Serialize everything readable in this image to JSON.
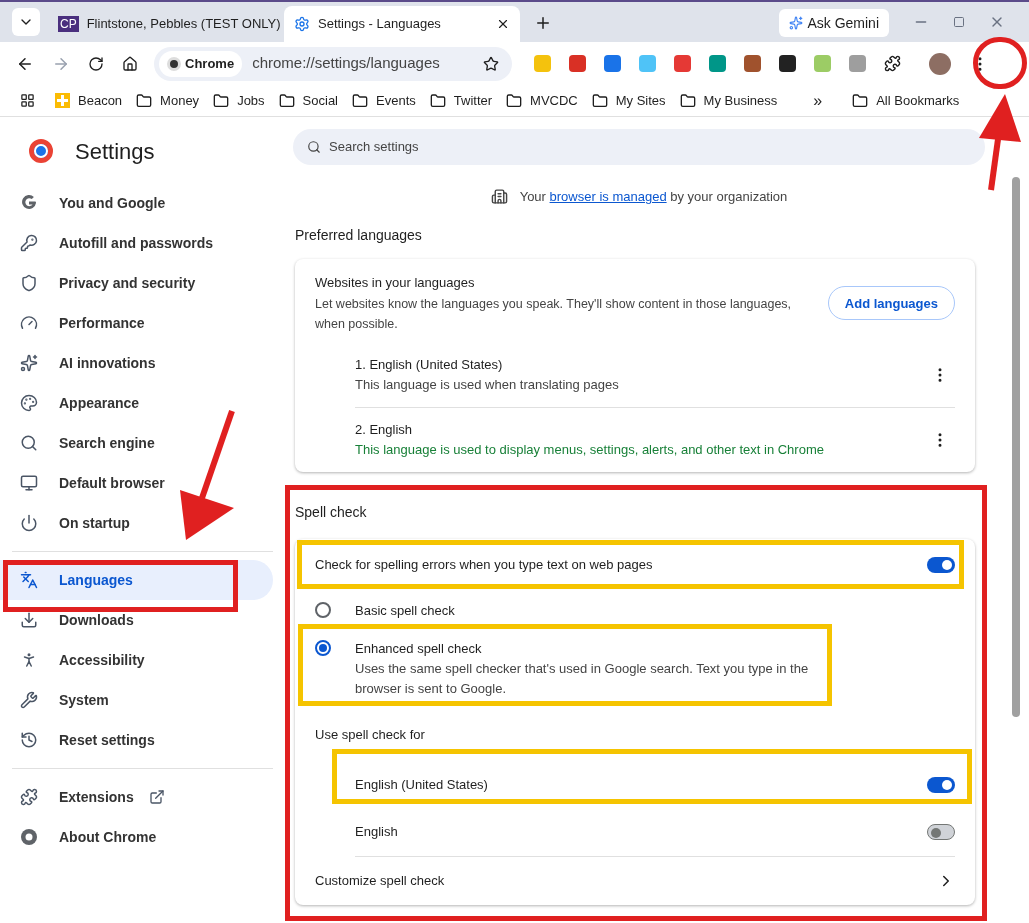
{
  "tabs": [
    {
      "badge": "CP",
      "label": "Flintstone, Pebbles (TEST ONLY)",
      "selected": false,
      "kind": "badge"
    },
    {
      "label": "Settings - Languages",
      "selected": true,
      "kind": "gear"
    }
  ],
  "gemini": "Ask Gemini",
  "address": {
    "chip": "Chrome",
    "url": "chrome://settings/languages"
  },
  "bookmarks": [
    {
      "label": "Beacon",
      "kind": "plus"
    },
    {
      "label": "Money",
      "kind": "folder"
    },
    {
      "label": "Jobs",
      "kind": "folder"
    },
    {
      "label": "Social",
      "kind": "folder"
    },
    {
      "label": "Events",
      "kind": "folder"
    },
    {
      "label": "Twitter",
      "kind": "folder"
    },
    {
      "label": "MVCDC",
      "kind": "folder"
    },
    {
      "label": "My Sites",
      "kind": "folder"
    },
    {
      "label": "My Business",
      "kind": "folder"
    }
  ],
  "overflow": "»",
  "all_bookmarks": "All Bookmarks",
  "sidebar": {
    "title": "Settings",
    "groups": [
      [
        {
          "label": "You and Google",
          "selected": false
        },
        {
          "label": "Autofill and passwords",
          "selected": false
        },
        {
          "label": "Privacy and security",
          "selected": false
        },
        {
          "label": "Performance",
          "selected": false
        },
        {
          "label": "AI innovations",
          "selected": false
        },
        {
          "label": "Appearance",
          "selected": false
        },
        {
          "label": "Search engine",
          "selected": false
        },
        {
          "label": "Default browser",
          "selected": false
        },
        {
          "label": "On startup",
          "selected": false
        }
      ],
      [
        {
          "label": "Languages",
          "selected": true
        },
        {
          "label": "Downloads",
          "selected": false
        },
        {
          "label": "Accessibility",
          "selected": false
        },
        {
          "label": "System",
          "selected": false
        },
        {
          "label": "Reset settings",
          "selected": false
        }
      ],
      [
        {
          "label": "Extensions",
          "selected": false
        },
        {
          "label": "About Chrome",
          "selected": false
        }
      ]
    ]
  },
  "search": {
    "placeholder": "Search settings"
  },
  "managed": {
    "before": "Your",
    "link": "browser is managed",
    "after": "by your organization"
  },
  "preferred": {
    "heading": "Preferred languages",
    "title": "Websites in your languages",
    "description": "Let websites know the languages you speak. They'll show content in those languages, when possible.",
    "button": "Add languages",
    "languages": [
      {
        "name": "1. English (United States)",
        "note": "This language is used when translating pages",
        "highlight": false
      },
      {
        "name": "2. English",
        "note": "This language is used to display menus, settings, alerts, and other text in Chrome",
        "highlight": true
      }
    ]
  },
  "spell": {
    "heading": "Spell check",
    "toggle": {
      "label": "Check for spelling errors when you type text on web pages",
      "on": true
    },
    "modes": [
      {
        "label": "Basic spell check",
        "selected": false
      },
      {
        "label": "Enhanced spell check",
        "description": "Uses the same spell checker that's used in Google search. Text you type in the browser is sent to Google.",
        "selected": true
      }
    ],
    "use_for": "Use spell check for",
    "languages": [
      {
        "label": "English (United States)",
        "on": true
      },
      {
        "label": "English",
        "on": false
      }
    ],
    "customize": "Customize spell check"
  }
}
